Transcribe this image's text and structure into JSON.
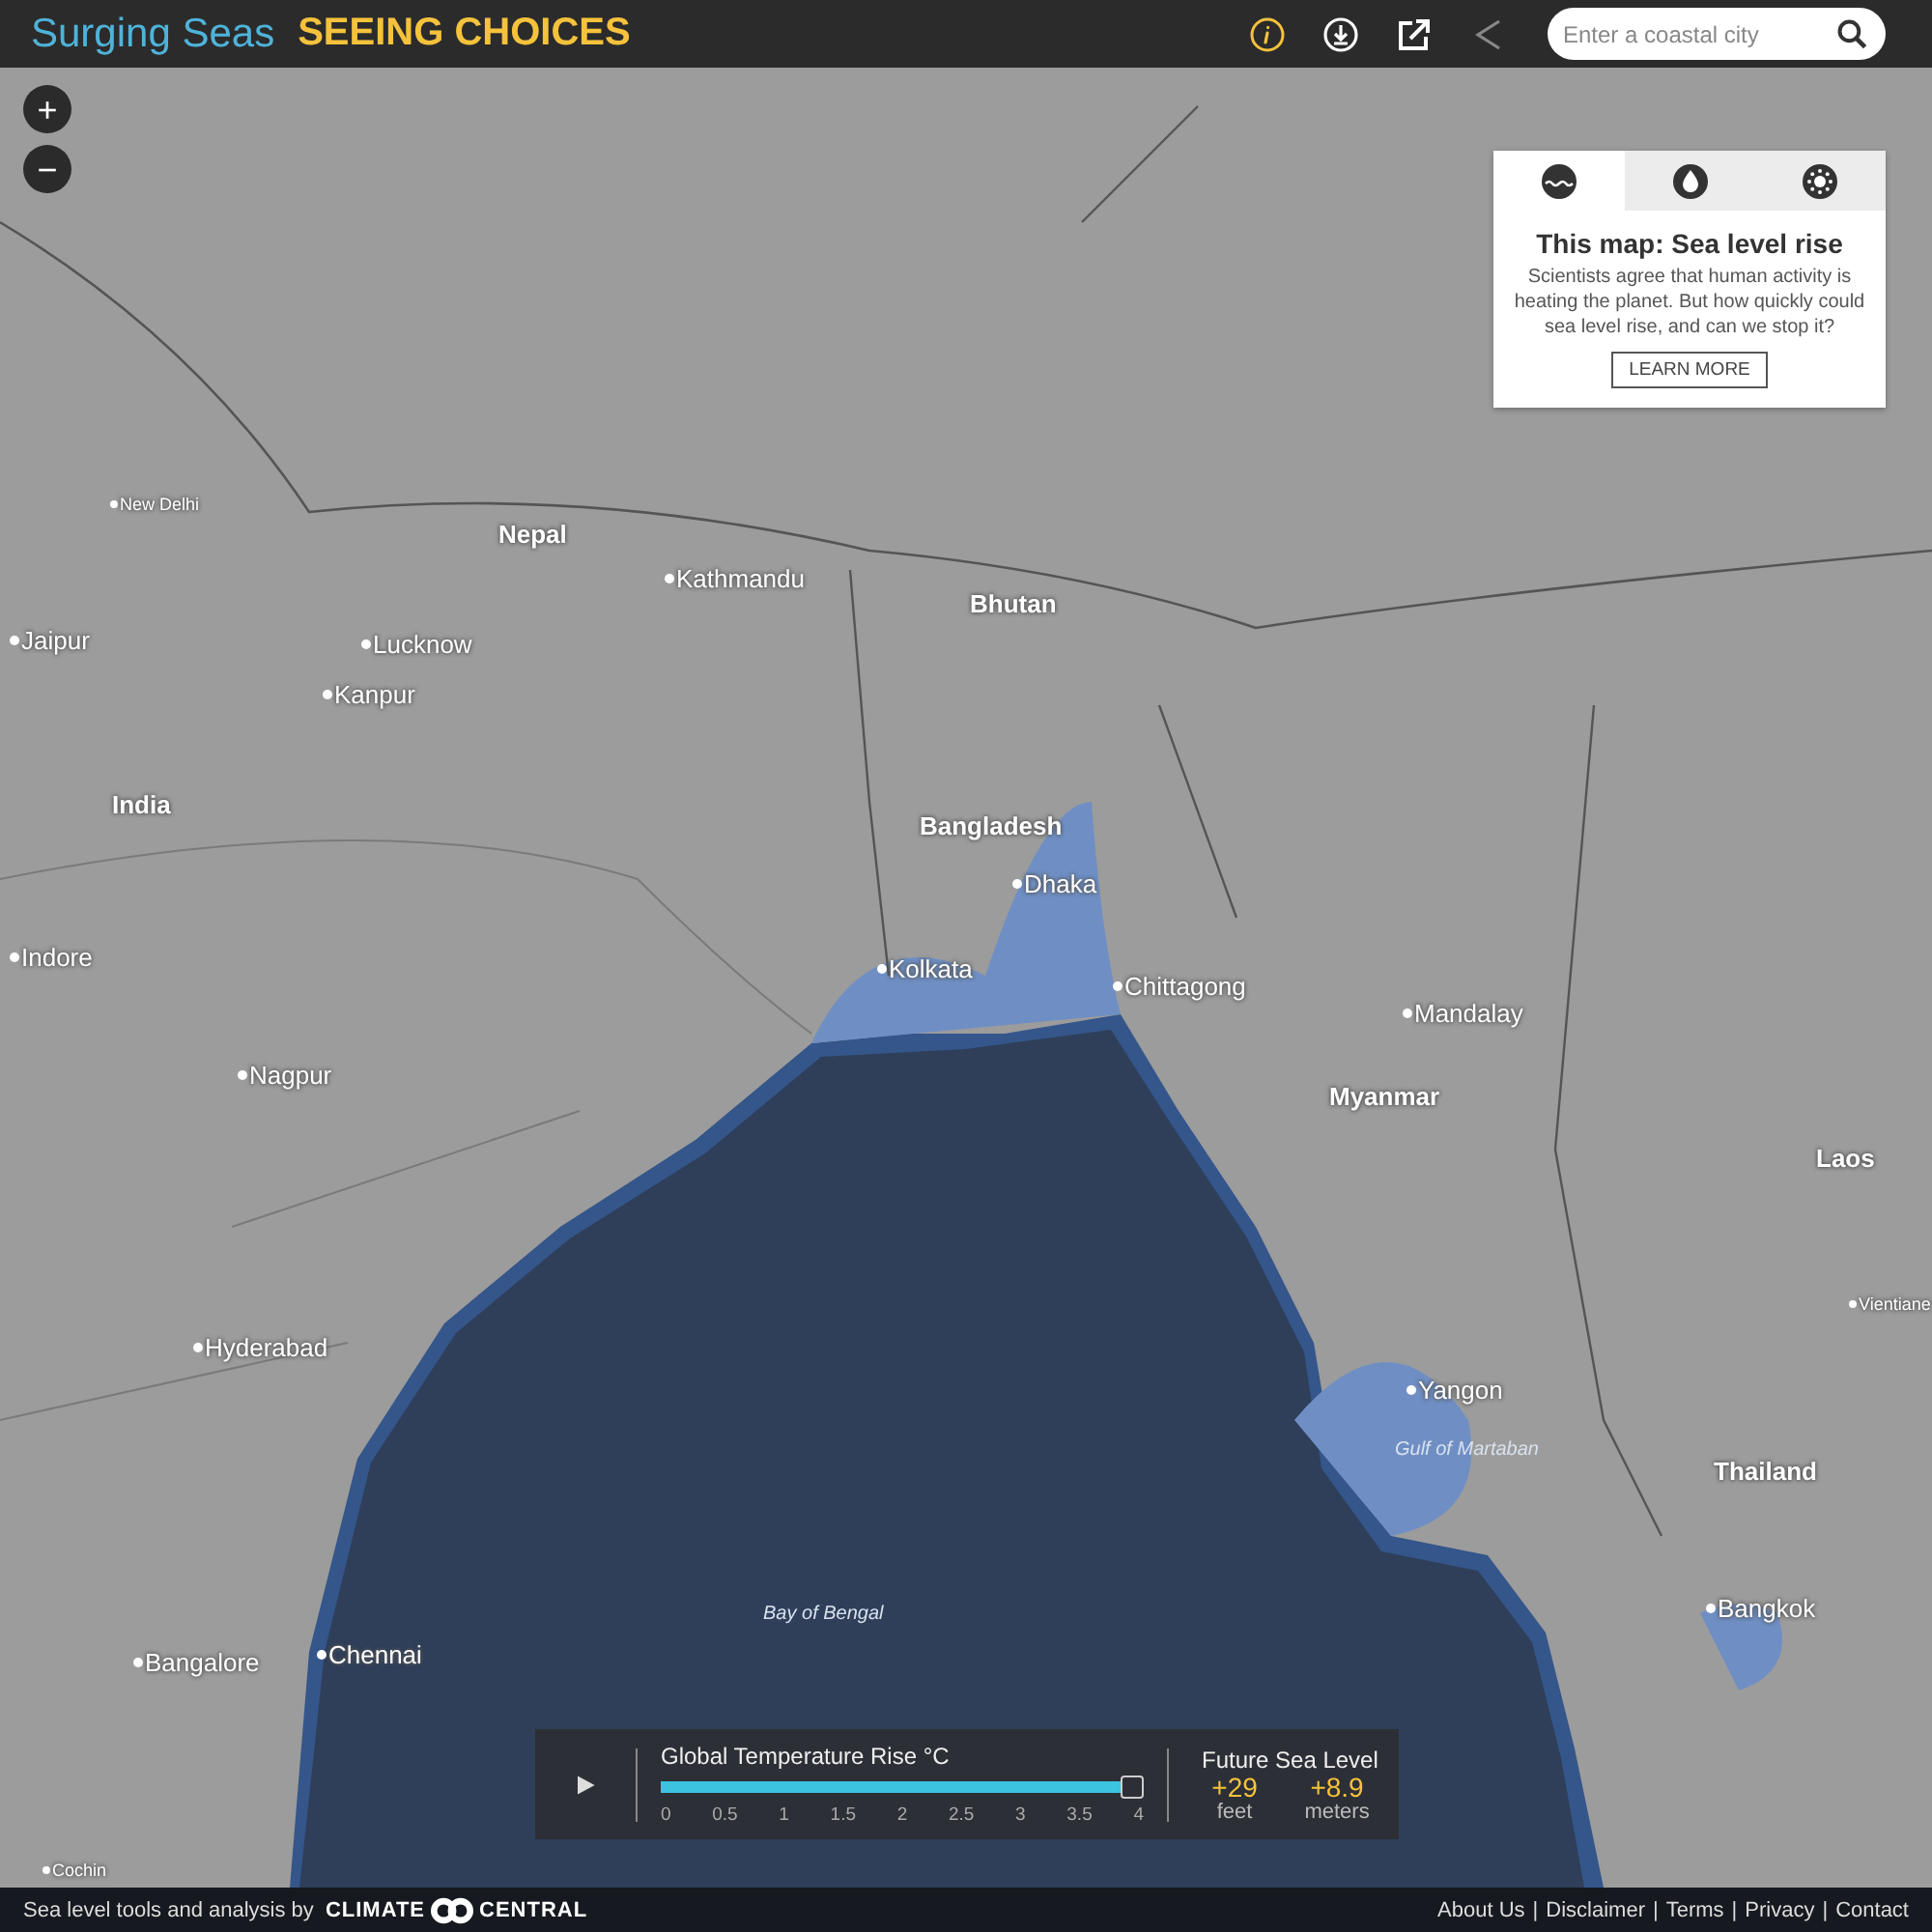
{
  "header": {
    "brand_primary": "Surging Seas",
    "brand_secondary": "SEEING CHOICES",
    "search": {
      "placeholder": "Enter a coastal city"
    }
  },
  "zoom_controls": [
    "+",
    "−"
  ],
  "info_panel": {
    "tabs": [
      {
        "kind": "sea",
        "selected": true
      },
      {
        "kind": "drop",
        "selected": false
      },
      {
        "kind": "sun",
        "selected": false
      }
    ],
    "title": "This map: Sea level rise",
    "body": "Scientists agree that human activity is heating the planet. But how quickly could sea level rise, and can we stop it?",
    "button": "LEARN MORE"
  },
  "map": {
    "labels": [
      {
        "kind": "city_small",
        "text": "New Delhi"
      },
      {
        "kind": "country",
        "text": "Nepal"
      },
      {
        "kind": "city",
        "text": "Kathmandu"
      },
      {
        "kind": "country",
        "text": "Bhutan"
      },
      {
        "kind": "city",
        "text": "Jaipur"
      },
      {
        "kind": "city",
        "text": "Lucknow"
      },
      {
        "kind": "city",
        "text": "Kanpur"
      },
      {
        "kind": "country",
        "text": "India"
      },
      {
        "kind": "country",
        "text": "Bangladesh"
      },
      {
        "kind": "city",
        "text": "Dhaka"
      },
      {
        "kind": "city",
        "text": "Indore"
      },
      {
        "kind": "city",
        "text": "Kolkata"
      },
      {
        "kind": "city",
        "text": "Chittagong"
      },
      {
        "kind": "city",
        "text": "Mandalay"
      },
      {
        "kind": "city",
        "text": "Nagpur"
      },
      {
        "kind": "country",
        "text": "Myanmar"
      },
      {
        "kind": "country",
        "text": "Laos"
      },
      {
        "kind": "city_small",
        "text": "Vientiane"
      },
      {
        "kind": "city",
        "text": "Hyderabad"
      },
      {
        "kind": "city",
        "text": "Yangon"
      },
      {
        "kind": "water",
        "text": "Gulf of Martaban"
      },
      {
        "kind": "country",
        "text": "Thailand"
      },
      {
        "kind": "city",
        "text": "Bangkok"
      },
      {
        "kind": "water",
        "text": "Bay of Bengal"
      },
      {
        "kind": "city",
        "text": "Bangalore"
      },
      {
        "kind": "city",
        "text": "Chennai"
      },
      {
        "kind": "city_small",
        "text": "Cochin"
      }
    ]
  },
  "temperature_control": {
    "title": "Global Temperature Rise °C",
    "level": 1,
    "ticks": [
      "0",
      "0.5",
      "1",
      "1.5",
      "2",
      "2.5",
      "3",
      "3.5",
      "4"
    ],
    "result_title": "Future Sea Level",
    "feet_value": "+29",
    "feet_unit": "feet",
    "meters_value": "+8.9",
    "meters_unit": "meters"
  },
  "footer": {
    "credit": "Sea level tools and analysis by",
    "logo_left": "CLIMATE",
    "logo_right": "CENTRAL",
    "links": [
      "About Us",
      "Disclaimer",
      "Terms",
      "Privacy",
      "Contact"
    ],
    "separator": "|"
  }
}
